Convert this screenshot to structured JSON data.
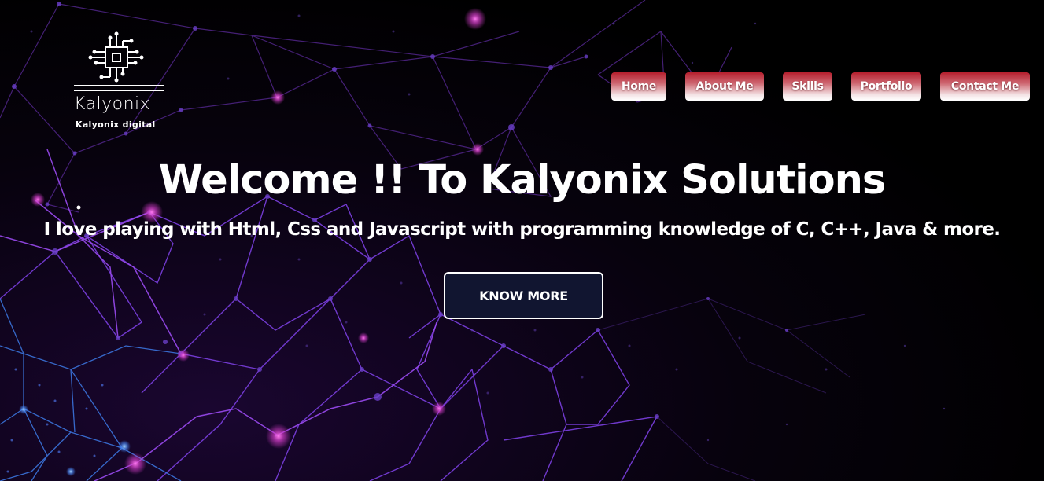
{
  "brand": {
    "name": "Kalyonix",
    "tagline": "Kalyonix digital",
    "logo_icon": "circuit-chip-icon"
  },
  "nav": {
    "items": [
      {
        "label": "Home"
      },
      {
        "label": "About Me"
      },
      {
        "label": "Skills"
      },
      {
        "label": "Portfolio"
      },
      {
        "label": "Contact Me"
      }
    ]
  },
  "hero": {
    "title": "Welcome !! To Kalyonix Solutions",
    "subtitle": "I love playing with Html, Css and Javascript with programming knowledge of C, C++, Java & more.",
    "cta_label": "KNOW MORE"
  },
  "colors": {
    "background": "#000000",
    "nav_button_top": "#b51e2c",
    "nav_button_bottom": "#ffffff",
    "cta_background": "#111530",
    "network_purple": "#7b3fe0",
    "network_magenta": "#e040d0",
    "network_blue": "#3d7be8"
  }
}
